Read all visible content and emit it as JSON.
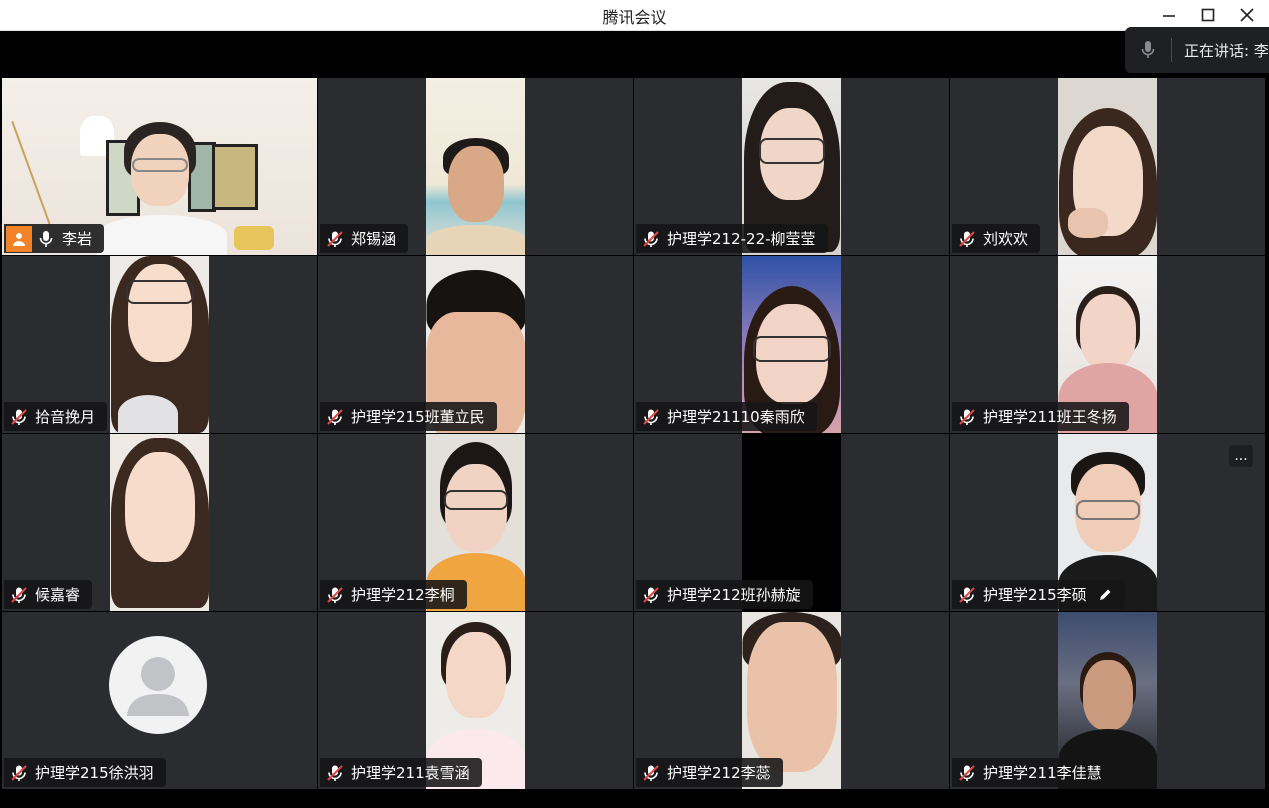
{
  "window": {
    "title": "腾讯会议"
  },
  "window_controls": {
    "minimize": "—",
    "maximize": "☐",
    "close": "✕"
  },
  "speaking_indicator": {
    "label": "正在讲话: 李"
  },
  "colors": {
    "active_border": "#2fb766",
    "host_badge": "#f18228",
    "tile_bg": "#2b2c30"
  },
  "participants": [
    {
      "name": "李岩",
      "muted": false,
      "host": true,
      "active": true
    },
    {
      "name": "郑锡涵",
      "muted": true
    },
    {
      "name": "护理学212-22-柳莹莹",
      "muted": true
    },
    {
      "name": "刘欢欢",
      "muted": true
    },
    {
      "name": "拾音挽月",
      "muted": true
    },
    {
      "name": "护理学215班董立民",
      "muted": true
    },
    {
      "name": "护理学21110秦雨欣",
      "muted": true
    },
    {
      "name": "护理学211班王冬扬",
      "muted": true
    },
    {
      "name": "候嘉睿",
      "muted": true
    },
    {
      "name": "护理学212李桐",
      "muted": true
    },
    {
      "name": "护理学212班孙赫旋",
      "muted": true
    },
    {
      "name": "护理学215李硕",
      "muted": true,
      "editing": true,
      "more": "..."
    },
    {
      "name": "护理学215徐洪羽",
      "muted": true,
      "avatar": "default-user-avatar"
    },
    {
      "name": "护理学211袁雪涵",
      "muted": true
    },
    {
      "name": "护理学212李蕊",
      "muted": true
    },
    {
      "name": "护理学211李佳慧",
      "muted": true
    }
  ]
}
